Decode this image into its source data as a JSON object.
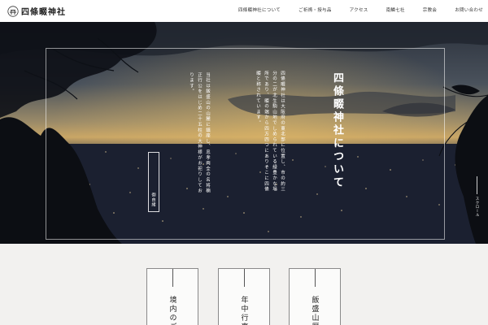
{
  "header": {
    "logo_text": "四條畷神社",
    "nav": [
      "四條畷神社について",
      "ご祈祷・授与品",
      "アクセス",
      "南鱗七社",
      "宗教会",
      "お問い合わせ"
    ]
  },
  "hero": {
    "title": "四條畷神社について",
    "paragraph1": "四條畷神社は大阪府の東北部に位置し、市の約三分の二が北生駒山地でしめられている緑豊かな場所であり、畷の端から四方四つにありそこに四條畷と称されています。",
    "paragraph2": "当社は飯盛山の山麓に鎮座し、忠孝両全の名将楠正行公をはじめ二十五柱の大神様がお祀りしております。",
    "button_label": "御由緒",
    "scroll_label": "スクロール"
  },
  "cards": [
    {
      "label": "境内のご"
    },
    {
      "label": "年中行事"
    },
    {
      "label": "飯盛山歴"
    }
  ],
  "colors": {
    "sky_top": "#2b3340",
    "sunset": "#c9a86a",
    "city": "#1a1e28",
    "lower_bg": "#f2f1ef"
  }
}
